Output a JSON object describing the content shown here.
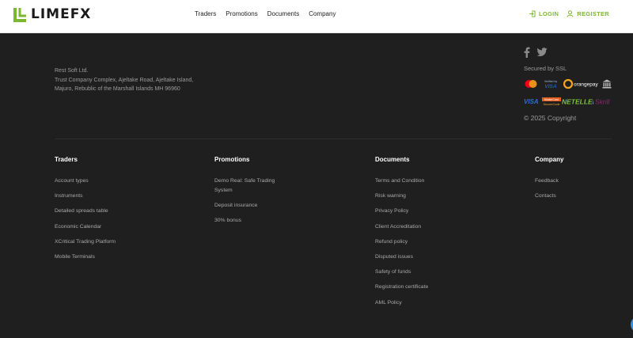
{
  "header": {
    "logo_text": "LIMEFX",
    "nav": [
      "Traders",
      "Promotions",
      "Documents",
      "Company"
    ],
    "login_label": "LOGIN",
    "register_label": "REGISTER"
  },
  "footer": {
    "company_lines": [
      "Rest Soft Ltd.",
      "Trust Company Complex, Ajeltake Road, Ajeltake Island,",
      "Majuro, Rebublic of the Marshall Islands MH 96960"
    ],
    "secured_label": "Secured by SSL",
    "copyright": "© 2025 Copyright",
    "payment_logos": {
      "row1": [
        "mastercard",
        "Verified by VISA",
        "orangepay",
        "bank"
      ],
      "row2": [
        "VISA",
        "Mastercard SecureCode",
        "NETELLER",
        "Skrill"
      ]
    },
    "columns": [
      {
        "title": "Traders",
        "links": [
          "Account types",
          "Instruments",
          "Detailed spreads table",
          "Economic Calendar",
          "XCritical Trading Platform",
          "Mobile Terminals"
        ]
      },
      {
        "title": "Promotions",
        "links": [
          "Demo Real: Safe Trading System",
          "Deposit insurance",
          "30% bonus"
        ]
      },
      {
        "title": "Documents",
        "links": [
          "Terms and Condition",
          "Risk warning",
          "Privacy Policy",
          "Client Accreditation",
          "Refund policy",
          "Disputed issues",
          "Safety of funds",
          "Registration certificate",
          "AML Policy"
        ]
      },
      {
        "title": "Company",
        "links": [
          "Feedback",
          "Contacts"
        ]
      }
    ]
  },
  "colors": {
    "accent": "#7cb82f",
    "footer_bg": "#1f1f1f",
    "header_bg": "#ffffff"
  }
}
